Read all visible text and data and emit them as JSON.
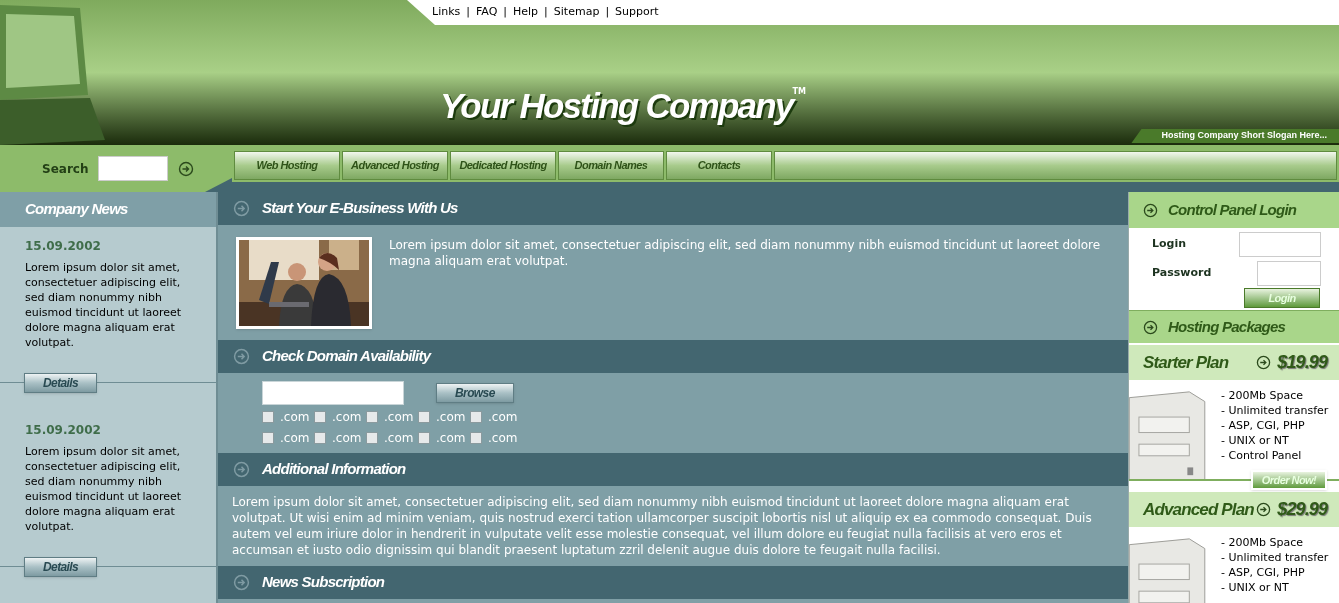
{
  "top_links": {
    "separator": "|",
    "items": [
      "Links",
      "FAQ",
      "Help",
      "Sitemap",
      "Support"
    ]
  },
  "logo": {
    "text": "Your Hosting Company",
    "mark": "TM"
  },
  "slogan": "Hosting Company Short Slogan Here...",
  "search": {
    "label": "Search"
  },
  "nav": [
    "Web Hosting",
    "Advanced Hosting",
    "Dedicated Hosting",
    "Domain Names",
    "Contacts"
  ],
  "news": {
    "title": "Company News",
    "items": [
      {
        "date": "15.09.2002",
        "text": "Lorem ipsum dolor sit amet, consectetuer adipiscing elit, sed diam nonummy nibh euismod tincidunt ut laoreet dolore magna aliquam erat volutpat.",
        "button": "Details"
      },
      {
        "date": "15.09.2002",
        "text": "Lorem ipsum dolor sit amet, consectetuer adipiscing elit, sed diam nonummy nibh euismod tincidunt ut laoreet dolore magna aliquam erat volutpat.",
        "button": "Details"
      }
    ]
  },
  "sections": [
    {
      "kind": "intro",
      "title": "Start Your E-Business With Us",
      "text": "Lorem ipsum dolor sit amet, consectetuer adipiscing elit, sed diam nonummy nibh euismod tincidunt ut laoreet dolore magna aliquam erat volutpat."
    },
    {
      "kind": "domain",
      "title": "Check Domain Availability",
      "button": "Browse",
      "options": [
        {
          "label": ".com",
          "checked": false
        },
        {
          "label": ".com",
          "checked": false
        },
        {
          "label": ".com",
          "checked": false
        },
        {
          "label": ".com",
          "checked": false
        },
        {
          "label": ".com",
          "checked": false
        },
        {
          "label": ".com",
          "checked": false
        },
        {
          "label": ".com",
          "checked": false
        },
        {
          "label": ".com",
          "checked": false
        },
        {
          "label": ".com",
          "checked": false
        },
        {
          "label": ".com",
          "checked": false
        }
      ]
    },
    {
      "kind": "text",
      "title": "Additional Information",
      "text": "Lorem ipsum dolor sit amet, consectetuer adipiscing elit, sed diam nonummy nibh euismod tincidunt ut laoreet dolore magna aliquam erat volutpat. Ut wisi enim ad minim veniam, quis nostrud exerci tation ullamcorper suscipit lobortis nisl ut aliquip ex ea commodo consequat. Duis autem vel eum iriure dolor in hendrerit in vulputate velit esse molestie consequat, vel illum dolore eu feugiat nulla facilisis at vero eros et accumsan et iusto odio dignissim qui blandit praesent luptatum zzril delenit augue duis dolore te feugait nulla facilisi."
    },
    {
      "kind": "header",
      "title": "News Subscription"
    }
  ],
  "login": {
    "title": "Control Panel Login",
    "fields": [
      "Login",
      "Password"
    ],
    "button": "Login"
  },
  "packages": {
    "title": "Hosting Packages",
    "plans": [
      {
        "name": "Starter Plan",
        "price": "$19.99",
        "features": [
          "- 200Mb Space",
          "- Unlimited transfer",
          "- ASP, CGI, PHP",
          "- UNIX or NT",
          "- Control Panel"
        ],
        "button": "Order Now!"
      },
      {
        "name": "Advanced Plan",
        "price": "$29.99",
        "features": [
          "- 200Mb Space",
          "- Unlimited transfer",
          "- ASP, CGI, PHP",
          "- UNIX or NT"
        ]
      }
    ]
  }
}
